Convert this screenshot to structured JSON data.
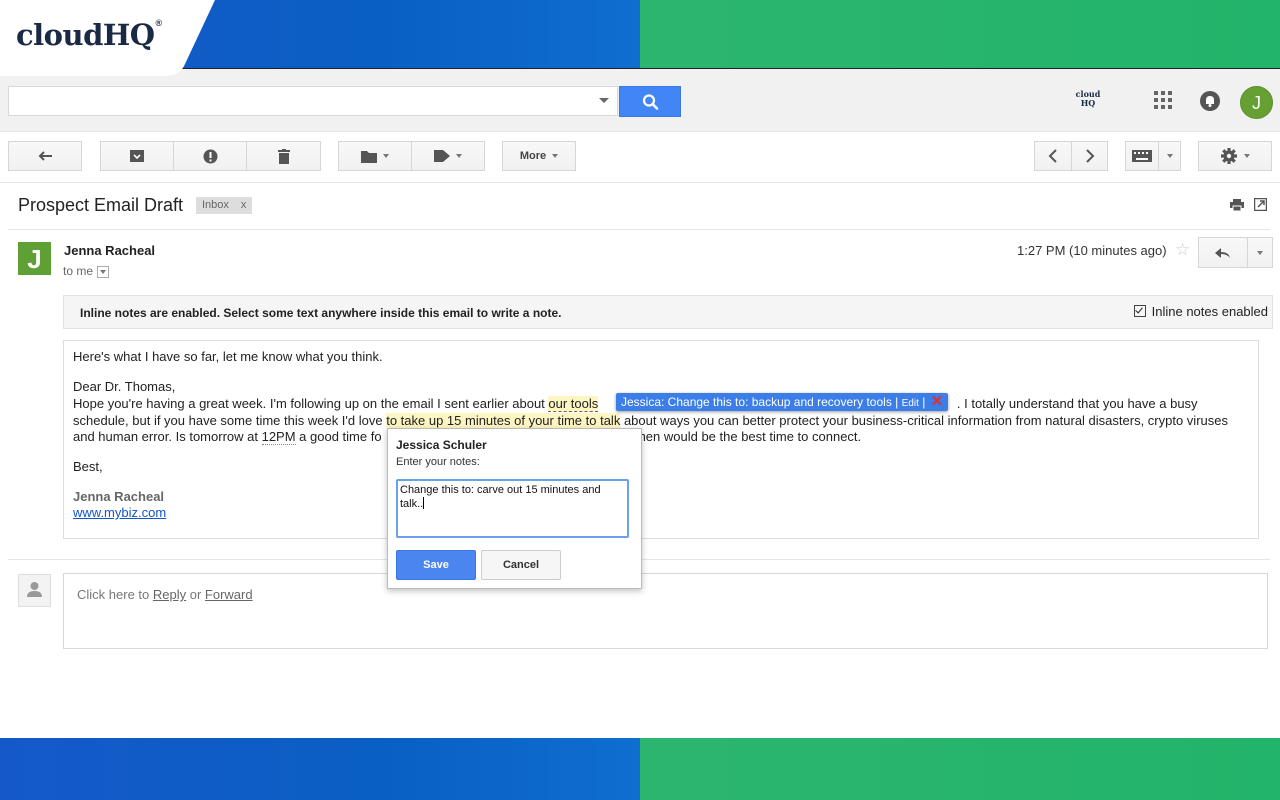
{
  "brand": {
    "logo_text": "cloudHQ",
    "logo_mark": "®",
    "header_logo": "cloud HQ"
  },
  "header": {
    "search_value": "",
    "search_placeholder": "",
    "avatar_letter": "J"
  },
  "toolbar": {
    "more_label": "More"
  },
  "email": {
    "subject": "Prospect Email Draft",
    "label_chip": "Inbox",
    "label_close": "x",
    "sender_name": "Jenna Racheal",
    "recipient": "to me",
    "time": "1:27 PM (10 minutes ago)",
    "sender_avatar": "J"
  },
  "notice": {
    "text": "Inline notes are enabled. Select some text anywhere inside this email to write a note.",
    "toggle_label": "Inline notes enabled"
  },
  "body": {
    "line1": "Here's what I have so far, let me know what you think.",
    "line2": "Dear Dr. Thomas,",
    "line3_a": "Hope you're having a great week. I'm following up on the email I sent earlier about ",
    "line3_hl": "our tools",
    "line3_b": " . I totally understand that you have a busy",
    "line4_a": "schedule, but if you have some time this week I'd love ",
    "line4_hl": "to take up 15 minutes of your time to talk",
    "line4_b": " about ways you can better protect your business-critical information from natural disasters, crypto viruses",
    "line5_a": "and human error. Is tomorrow at ",
    "line5_ul": "12PM",
    "line5_b": " a good time fo",
    "line5_c": "hen would be the best time to connect.",
    "line6": "Best,",
    "sig_name": "Jenna Racheal",
    "sig_link": "www.mybiz.com"
  },
  "note_tag": {
    "text": "Jessica: Change this to: backup and recovery tools",
    "sep1": " | ",
    "edit": "Edit",
    "sep2": " | ",
    "close": "✕"
  },
  "note_popup": {
    "author": "Jessica Schuler",
    "prompt": "Enter your notes:",
    "value": "Change this to: carve out 15 minutes and talk..",
    "save_label": "Save",
    "cancel_label": "Cancel"
  },
  "reply": {
    "prefix": "Click here to ",
    "reply_link": "Reply",
    "middle": " or ",
    "forward_link": "Forward"
  },
  "colors": {
    "accent": "#4285f4",
    "brand_blue": "#0a5fc4",
    "brand_green": "#22b46a",
    "highlight": "#fdf5c2"
  }
}
